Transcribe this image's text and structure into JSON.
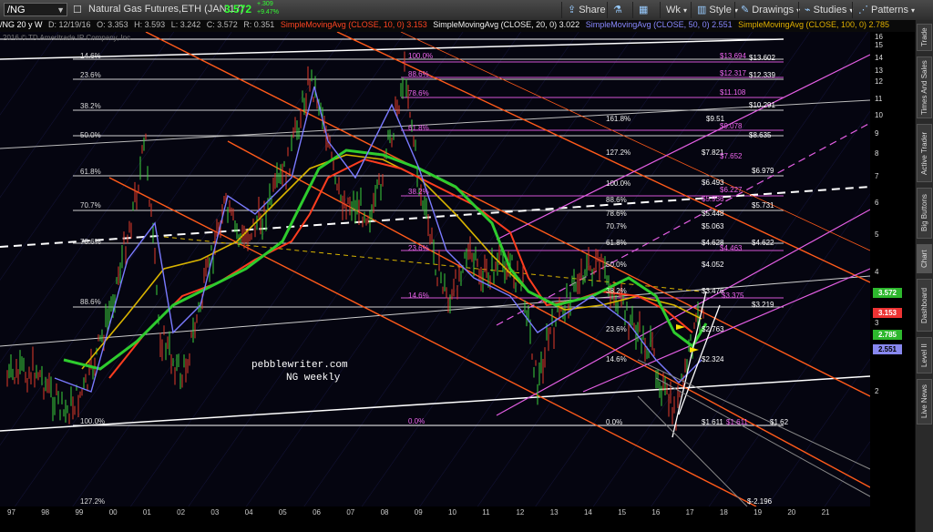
{
  "toolbar": {
    "symbol": "/NG",
    "title": "Natural Gas Futures,ETH (JAN 17)",
    "last_price": "3.572",
    "change": "+.309",
    "change_pct": "+9.47%",
    "buttons": [
      "Share",
      "Wk",
      "Style",
      "Drawings",
      "Studies",
      "Patterns"
    ]
  },
  "info": {
    "timeframe": "/NG 20 y W",
    "date": "D: 12/19/16",
    "open": "O: 3.353",
    "high": "H: 3.593",
    "low": "L: 3.242",
    "close": "C: 3.572",
    "range": "R: 0.351",
    "sma10": "SimpleMovingAvg (CLOSE, 10, 0) 3.153",
    "sma20": "SimpleMovingAvg (CLOSE, 20, 0) 3.022",
    "sma50": "SimpleMovingAvg (CLOSE, 50, 0) 2.551",
    "sma100": "SimpleMovingAvg (CLOSE, 100, 0) 2.785"
  },
  "copyright": "2016 © TD Ameritrade IP Company, Inc.",
  "watermark": {
    "line1": "pebblewriter.com",
    "line2": "NG weekly"
  },
  "sidebar_tabs": [
    "Trade",
    "Times And Sales",
    "Active Trader",
    "Big Buttons",
    "Chart",
    "Dashboard",
    "Level II",
    "Live News"
  ],
  "price_axis_labels": [
    "16",
    "15",
    "14",
    "13",
    "12",
    "11",
    "10",
    "9",
    "8",
    "7",
    "6",
    "5",
    "4",
    "3",
    "2"
  ],
  "price_tags": [
    {
      "label": "3.572",
      "color": "#2db82d"
    },
    {
      "label": "3.153",
      "color": "#e33"
    },
    {
      "label": "2.785",
      "color": "#2db82d"
    },
    {
      "label": "2.551",
      "color": "#8888ee"
    }
  ],
  "x_axis_labels": [
    "97",
    "98",
    "99",
    "00",
    "01",
    "02",
    "03",
    "04",
    "05",
    "06",
    "07",
    "08",
    "09",
    "10",
    "11",
    "12",
    "13",
    "14",
    "15",
    "16",
    "17",
    "18",
    "19",
    "20",
    "21"
  ],
  "fib_left": [
    "14.6%",
    "23.6%",
    "38.2%",
    "50.0%",
    "61.8%",
    "70.7%",
    "78.6%",
    "88.6%",
    "100.0%",
    "127.2%"
  ],
  "fib_mid": [
    "100.0%",
    "88.6%",
    "78.6%",
    "61.8%",
    "38.2%",
    "23.6%",
    "14.6%",
    "0.0%"
  ],
  "fib_right": [
    "161.8%",
    "127.2%",
    "100.0%",
    "88.6%",
    "78.6%",
    "70.7%",
    "61.8%",
    "50.0%",
    "38.2%",
    "23.6%",
    "14.6%",
    "0.0%"
  ],
  "price_levels": [
    "$13.694",
    "$13.602",
    "$12.317",
    "$12.339",
    "$11.108",
    "$10.291",
    "$9.51",
    "$9.078",
    "$8.635",
    "$7.821",
    "$7.652",
    "$6.979",
    "$6.493",
    "$6.227",
    "$5.936",
    "$5.731",
    "$5.448",
    "$5.063",
    "$4.628",
    "$4.463",
    "$4.622",
    "$4.052",
    "$3.476",
    "$3.375",
    "$3.219",
    "$2.763",
    "$2.324",
    "$1.611",
    "$1.611",
    "$1.62",
    "$-2.196"
  ],
  "colors": {
    "bg": "#000",
    "orange": "#ff5a1a",
    "magenta": "#ee66ee",
    "green": "#2ecc2e",
    "sma_red": "#ff3d1f",
    "sma_yellow": "#d9b400",
    "sma_blue": "#7a7aff"
  }
}
